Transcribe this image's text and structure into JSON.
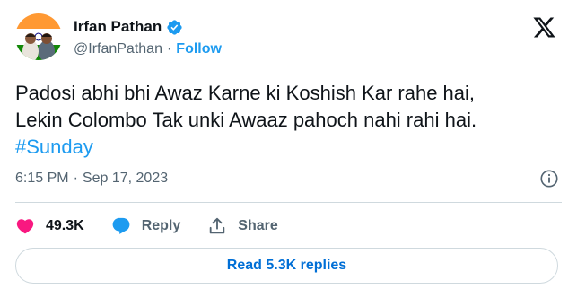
{
  "author": {
    "name": "Irfan Pathan",
    "handle": "@IrfanPathan",
    "separator": "·",
    "follow_label": "Follow",
    "verified_icon": "verified-badge-icon",
    "verified_color": "#1d9bf0"
  },
  "platform": {
    "logo_icon": "x-logo-icon"
  },
  "tweet": {
    "line1": "Padosi abhi bhi Awaz Karne ki Koshish Kar rahe hai,",
    "line2": "Lekin Colombo Tak unki Awaaz pahoch nahi rahi hai.",
    "hashtag": "#Sunday",
    "time": "6:15 PM",
    "separator": "·",
    "date": "Sep 17, 2023",
    "info_icon": "info-icon"
  },
  "actions": {
    "likes": {
      "label": "49.3K",
      "icon": "heart-icon",
      "color": "#f91880"
    },
    "reply": {
      "label": "Reply",
      "icon": "reply-bubble-icon",
      "color": "#1d9bf0"
    },
    "share": {
      "label": "Share",
      "icon": "share-icon"
    }
  },
  "replies_button": {
    "label": "Read 5.3K replies",
    "color": "#006fd6"
  },
  "colors": {
    "text": "#0f1419",
    "muted": "#536471",
    "accent": "#1d9bf0",
    "border": "#cfd9de"
  }
}
